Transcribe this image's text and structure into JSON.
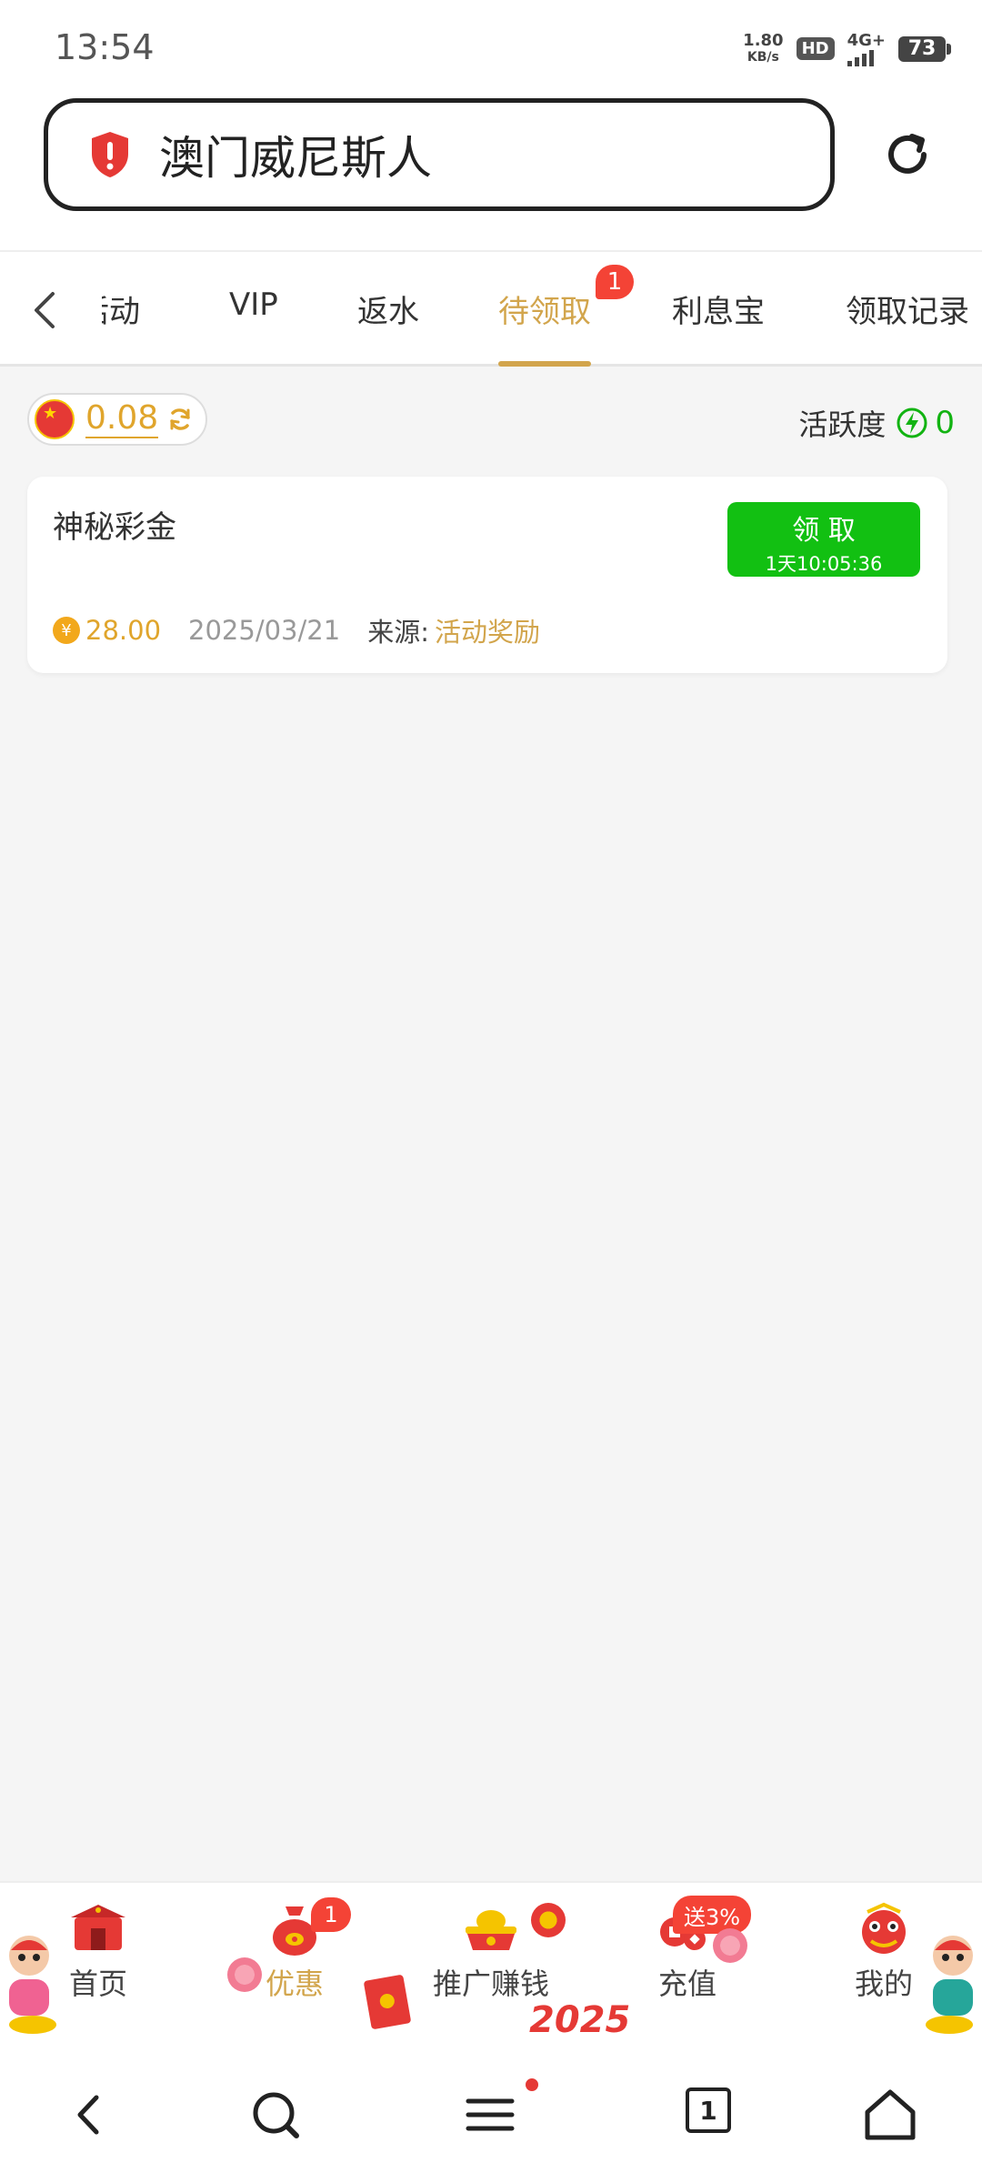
{
  "status_bar": {
    "time": "13:54",
    "net_speed_value": "1.80",
    "net_speed_unit": "KB/s",
    "hd": "HD",
    "signal": "4G+",
    "battery": "73"
  },
  "url_bar": {
    "title": "澳门威尼斯人",
    "shield_icon": "shield-alert-icon",
    "reload_icon": "reload-icon"
  },
  "tabs": {
    "items": [
      {
        "label": "活动"
      },
      {
        "label": "VIP"
      },
      {
        "label": "返水"
      },
      {
        "label": "待领取",
        "active": true,
        "badge": "1"
      },
      {
        "label": "利息宝"
      },
      {
        "label": "领取记录"
      }
    ]
  },
  "balance": {
    "value": "0.08",
    "flag": "china-flag-icon"
  },
  "activity": {
    "label": "活跃度",
    "value": "0"
  },
  "reward_card": {
    "title": "神秘彩金",
    "button_label": "领 取",
    "countdown": "1天10:05:36",
    "coin_symbol": "¥",
    "amount": "28.00",
    "date": "2025/03/21",
    "source_label": "来源:",
    "source_value": "活动奖励"
  },
  "bottom_nav": {
    "items": [
      {
        "label": "首页"
      },
      {
        "label": "优惠",
        "active": true,
        "badge": "1"
      },
      {
        "label": "推广赚钱"
      },
      {
        "label": "充值",
        "promo": "送3%"
      },
      {
        "label": "我的"
      }
    ],
    "decoration_text": "2025"
  },
  "system_nav": {
    "tab_count": "1"
  },
  "colors": {
    "accent_gold": "#d2a54c",
    "claim_green": "#12c012",
    "badge_red": "#f44336",
    "activity_green": "#12b312"
  }
}
